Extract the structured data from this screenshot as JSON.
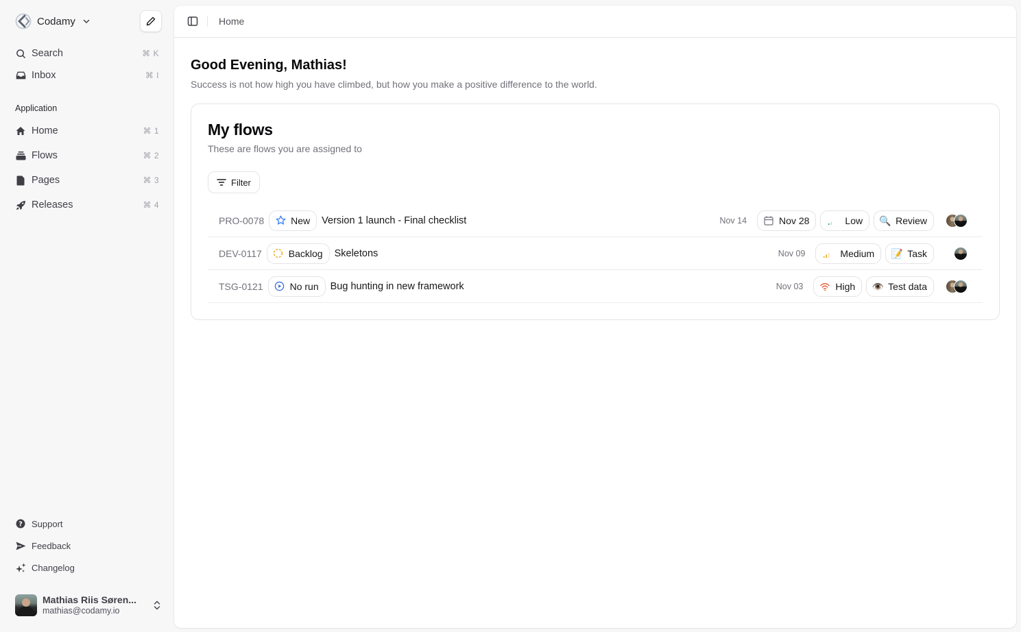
{
  "sidebar": {
    "workspace": {
      "name": "Codamy",
      "logo_icon": "codamy-logo-icon",
      "chevron_icon": "chevron-down-icon"
    },
    "compose_icon": "pencil-icon",
    "top_items": [
      {
        "label": "Search",
        "shortcut": "⌘ K",
        "icon": "search-icon"
      },
      {
        "label": "Inbox",
        "shortcut": "⌘ I",
        "icon": "inbox-icon"
      }
    ],
    "section_label": "Application",
    "app_items": [
      {
        "label": "Home",
        "shortcut": "⌘ 1",
        "icon": "home-icon"
      },
      {
        "label": "Flows",
        "shortcut": "⌘ 2",
        "icon": "stack-icon"
      },
      {
        "label": "Pages",
        "shortcut": "⌘ 3",
        "icon": "page-icon"
      },
      {
        "label": "Releases",
        "shortcut": "⌘ 4",
        "icon": "rocket-icon"
      }
    ],
    "footer_items": [
      {
        "label": "Support",
        "icon": "question-circle-icon"
      },
      {
        "label": "Feedback",
        "icon": "send-icon"
      },
      {
        "label": "Changelog",
        "icon": "sparkles-icon"
      }
    ],
    "user": {
      "name": "Mathias Riis Søren...",
      "email": "mathias@codamy.io"
    }
  },
  "topbar": {
    "breadcrumb": "Home"
  },
  "main": {
    "greeting": "Good Evening, Mathias!",
    "quote": "Success is not how high you have climbed, but how you make a positive difference to the world.",
    "card": {
      "title": "My flows",
      "subtitle": "These are flows you are assigned to",
      "filter_label": "Filter",
      "rows": [
        {
          "id": "PRO-0078",
          "status": {
            "label": "New",
            "icon": "star-icon"
          },
          "title": "Version 1 launch - Final checklist",
          "date": "Nov 14",
          "due": "Nov 28",
          "priority": {
            "label": "Low",
            "color": "#22a06b"
          },
          "type": {
            "label": "Review",
            "emoji": "🔍"
          },
          "assignees": 2
        },
        {
          "id": "DEV-0117",
          "status": {
            "label": "Backlog",
            "icon": "dashed-circle-icon"
          },
          "title": "Skeletons",
          "date": "Nov 09",
          "priority": {
            "label": "Medium",
            "color": "#e5a00d"
          },
          "type": {
            "label": "Task",
            "emoji": "📝"
          },
          "assignees": 1
        },
        {
          "id": "TSG-0121",
          "status": {
            "label": "No run",
            "icon": "play-circle-icon"
          },
          "title": "Bug hunting in new framework",
          "date": "Nov 03",
          "priority": {
            "label": "High",
            "color": "#e0603a"
          },
          "type": {
            "label": "Test data",
            "emoji": "👁️"
          },
          "assignees": 2
        }
      ]
    }
  },
  "colors": {
    "status_new": "#3b82f6",
    "status_backlog": "#e5a00d",
    "status_norun": "#3b6fd6"
  }
}
